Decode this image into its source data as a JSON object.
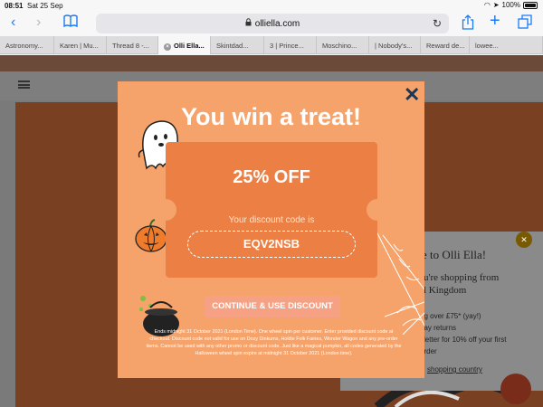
{
  "status": {
    "time": "08:51",
    "date": "Sat 25 Sep",
    "battery": "100%"
  },
  "address_bar": {
    "url": "olliella.com"
  },
  "tabs": [
    {
      "label": "Astronomy..."
    },
    {
      "label": "Karen | Mu..."
    },
    {
      "label": "Thread 8 -..."
    },
    {
      "label": "Olli Ella..."
    },
    {
      "label": "Skintdad..."
    },
    {
      "label": "3 | Prince..."
    },
    {
      "label": "Moschino..."
    },
    {
      "label": "| Nobody's..."
    },
    {
      "label": "Reward de..."
    },
    {
      "label": "lowee..."
    }
  ],
  "modal": {
    "title": "You win a treat!",
    "discount": "25% OFF",
    "code_label": "Your discount code is",
    "code": "EQV2NSB",
    "cta": "CONTINUE & USE DISCOUNT",
    "terms": "Ends midnight 31 October 2021 (London Time). One wheel spin per customer. Enter provided discount code at checkout. Discount code not valid for use on Dozy Dinkums, Holdie Folk Fairies, Wonder Wagon and any pre-order items. Cannot be used with any other promo or discount code. Just like a magical pumpkin, all codes generated by the Halloween wheel spin expire at midnight 31 October 2021 (London time).",
    "colors": {
      "background": "#f5a36a",
      "ticket": "#ec8044",
      "close": "#1b3757"
    }
  },
  "side_panel": {
    "welcome": "e to Olli Ella!",
    "shopping_from": "u're shopping from",
    "country": "l Kingdom",
    "list": [
      "ng over £75* (yay!)",
      "day returns",
      "sletter for 10% off your first",
      "order"
    ],
    "change_link": "shopping country"
  }
}
